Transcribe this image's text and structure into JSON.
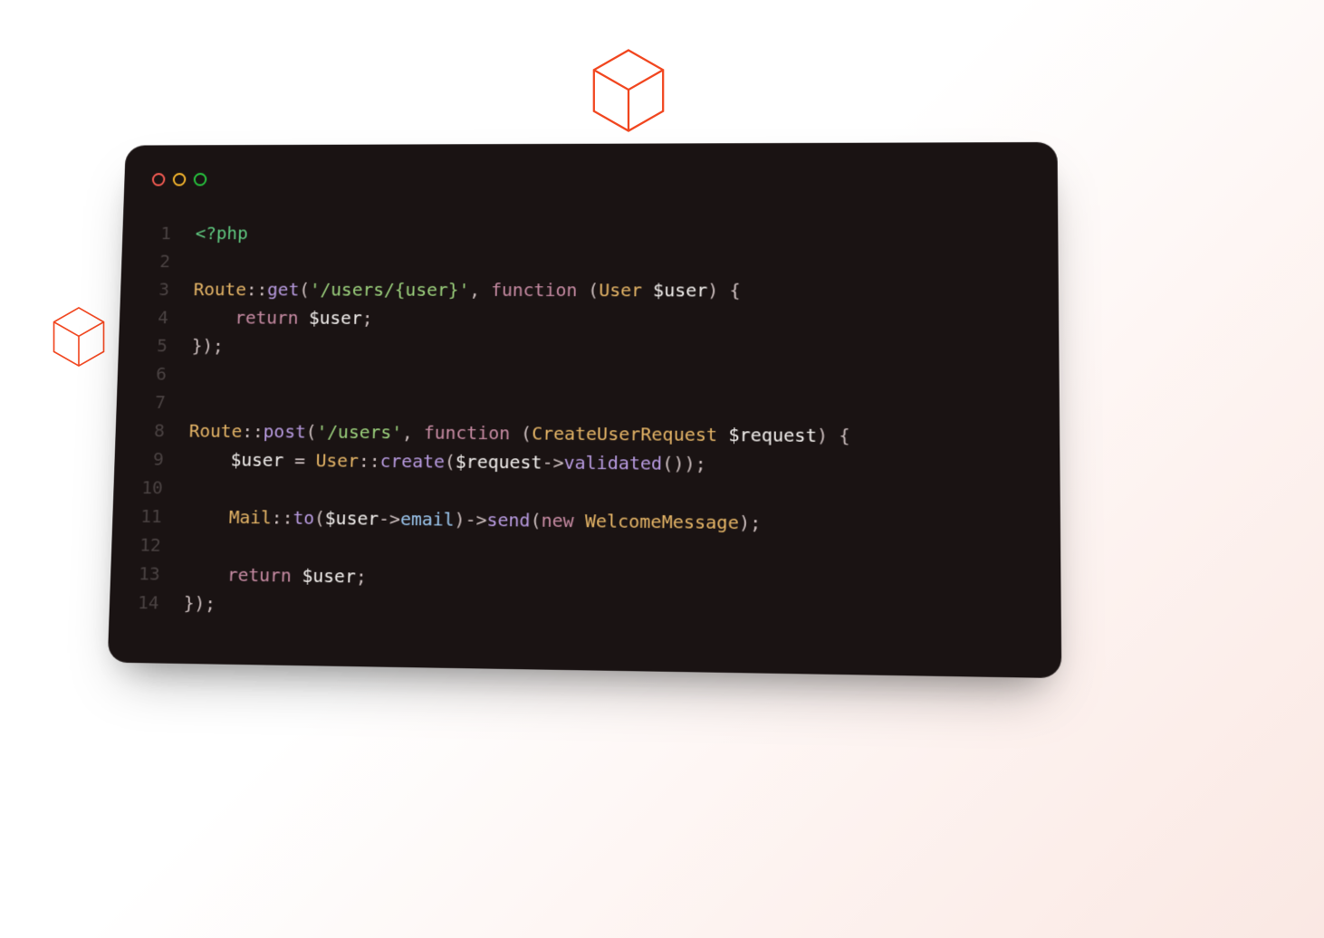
{
  "decorations": {
    "cube_large": "cube-icon",
    "cube_small": "cube-icon"
  },
  "editor": {
    "traffic_lights": [
      "red",
      "yellow",
      "green"
    ],
    "line_numbers": [
      "1",
      "2",
      "3",
      "4",
      "5",
      "6",
      "7",
      "8",
      "9",
      "10",
      "11",
      "12",
      "13",
      "14"
    ],
    "code": {
      "plaintext": "<?php\n\nRoute::get('/users/{user}', function (User $user) {\n    return $user;\n});\n\n\nRoute::post('/users', function (CreateUserRequest $request) {\n    $user = User::create($request->validated());\n\n    Mail::to($user->email)->send(new WelcomeMessage);\n\n    return $user;\n});",
      "lines": [
        [
          {
            "t": "tag",
            "v": "<?php"
          }
        ],
        [],
        [
          {
            "t": "class",
            "v": "Route"
          },
          {
            "t": "punc",
            "v": "::"
          },
          {
            "t": "func",
            "v": "get"
          },
          {
            "t": "punc",
            "v": "("
          },
          {
            "t": "string",
            "v": "'/users/{user}'"
          },
          {
            "t": "punc",
            "v": ", "
          },
          {
            "t": "keyword",
            "v": "function"
          },
          {
            "t": "punc",
            "v": " ("
          },
          {
            "t": "class",
            "v": "User"
          },
          {
            "t": "punc",
            "v": " "
          },
          {
            "t": "var",
            "v": "$user"
          },
          {
            "t": "punc",
            "v": ") {"
          }
        ],
        [
          {
            "t": "punc",
            "v": "    "
          },
          {
            "t": "keyword",
            "v": "return"
          },
          {
            "t": "punc",
            "v": " "
          },
          {
            "t": "var",
            "v": "$user"
          },
          {
            "t": "punc",
            "v": ";"
          }
        ],
        [
          {
            "t": "punc",
            "v": "});"
          }
        ],
        [],
        [],
        [
          {
            "t": "class",
            "v": "Route"
          },
          {
            "t": "punc",
            "v": "::"
          },
          {
            "t": "func",
            "v": "post"
          },
          {
            "t": "punc",
            "v": "("
          },
          {
            "t": "string",
            "v": "'/users'"
          },
          {
            "t": "punc",
            "v": ", "
          },
          {
            "t": "keyword",
            "v": "function"
          },
          {
            "t": "punc",
            "v": " ("
          },
          {
            "t": "class",
            "v": "CreateUserRequest"
          },
          {
            "t": "punc",
            "v": " "
          },
          {
            "t": "var",
            "v": "$request"
          },
          {
            "t": "punc",
            "v": ") {"
          }
        ],
        [
          {
            "t": "punc",
            "v": "    "
          },
          {
            "t": "var",
            "v": "$user"
          },
          {
            "t": "punc",
            "v": " = "
          },
          {
            "t": "class",
            "v": "User"
          },
          {
            "t": "punc",
            "v": "::"
          },
          {
            "t": "func",
            "v": "create"
          },
          {
            "t": "punc",
            "v": "("
          },
          {
            "t": "var",
            "v": "$request"
          },
          {
            "t": "punc",
            "v": "->"
          },
          {
            "t": "func",
            "v": "validated"
          },
          {
            "t": "punc",
            "v": "());"
          }
        ],
        [],
        [
          {
            "t": "punc",
            "v": "    "
          },
          {
            "t": "class",
            "v": "Mail"
          },
          {
            "t": "punc",
            "v": "::"
          },
          {
            "t": "func",
            "v": "to"
          },
          {
            "t": "punc",
            "v": "("
          },
          {
            "t": "var",
            "v": "$user"
          },
          {
            "t": "punc",
            "v": "->"
          },
          {
            "t": "prop",
            "v": "email"
          },
          {
            "t": "punc",
            "v": ")->"
          },
          {
            "t": "func",
            "v": "send"
          },
          {
            "t": "punc",
            "v": "("
          },
          {
            "t": "keyword",
            "v": "new"
          },
          {
            "t": "punc",
            "v": " "
          },
          {
            "t": "class",
            "v": "WelcomeMessage"
          },
          {
            "t": "punc",
            "v": ");"
          }
        ],
        [],
        [
          {
            "t": "punc",
            "v": "    "
          },
          {
            "t": "keyword",
            "v": "return"
          },
          {
            "t": "punc",
            "v": " "
          },
          {
            "t": "var",
            "v": "$user"
          },
          {
            "t": "punc",
            "v": ";"
          }
        ],
        [
          {
            "t": "punc",
            "v": "});"
          }
        ]
      ]
    }
  }
}
